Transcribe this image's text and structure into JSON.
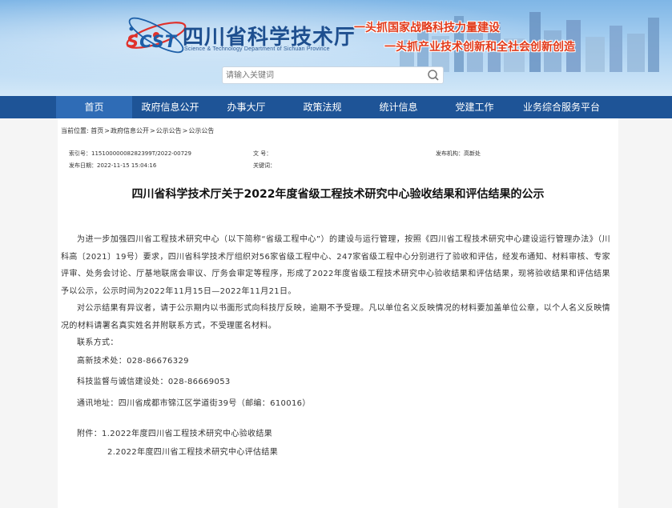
{
  "header": {
    "logo_text_s": "S",
    "logo_text_cst": "CST",
    "site_title": "四川省科学技术厅",
    "site_subtitle": "Science & Technology Department of Sichuan Province",
    "slogan1": "一头抓国家战略科技力量建设",
    "slogan2": "一头抓产业技术创新和全社会创新创造",
    "search": {
      "placeholder": "请输入关键词"
    }
  },
  "nav": {
    "items": [
      {
        "label": "首页"
      },
      {
        "label": "政府信息公开"
      },
      {
        "label": "办事大厅"
      },
      {
        "label": "政策法规"
      },
      {
        "label": "统计信息"
      },
      {
        "label": "党建工作"
      },
      {
        "label": "业务综合服务平台"
      }
    ]
  },
  "breadcrumb": {
    "prefix": "当前位置:",
    "items": [
      "首页",
      "政府信息公开",
      "公示公告",
      "公示公告"
    ],
    "sep": ">"
  },
  "meta": {
    "index_no": "索引号：11510000008282399T/2022-00729",
    "publish_date": "发布日期：2022-11-15 15:04:16",
    "doc_no": "文  号：",
    "keywords": "关键词：",
    "issuer": "发布机构：高新处"
  },
  "article": {
    "title": "四川省科学技术厅关于2022年度省级工程技术研究中心验收结果和评估结果的公示",
    "para1": "为进一步加强四川省工程技术研究中心（以下简称“省级工程中心”）的建设与运行管理，按照《四川省工程技术研究中心建设运行管理办法》（川科高〔2021〕19号）要求，四川省科学技术厅组织对56家省级工程中心、247家省级工程中心分别进行了验收和评估，经发布通知、材料审核、专家评审、处务会讨论、厅基地联席会审议、厅务会审定等程序，形成了2022年度省级工程技术研究中心验收结果和评估结果，现将验收结果和评估结果予以公示，公示时间为2022年11月15日—2022年11月21日。",
    "para2": "对公示结果有异议者，请于公示期内以书面形式向科技厅反映，逾期不予受理。凡以单位名义反映情况的材料要加盖单位公章，以个人名义反映情况的材料请署名真实姓名并附联系方式，不受理匿名材料。",
    "contact_label": "联系方式：",
    "contact1": "高新技术处：028-86676329",
    "contact2": "科技监督与诚信建设处：028-86669053",
    "address": "通讯地址：四川省成都市锦江区学道街39号（邮编：610016）",
    "attach1": "附件：1.2022年度四川省工程技术研究中心验收结果",
    "attach2": "2.2022年度四川省工程技术研究中心评估结果"
  },
  "colors": {
    "nav_bg": "#1e5497",
    "nav_active": "#2f6cb6",
    "title_blue": "#1e4f8f",
    "slogan_red": "#e23a1a"
  }
}
